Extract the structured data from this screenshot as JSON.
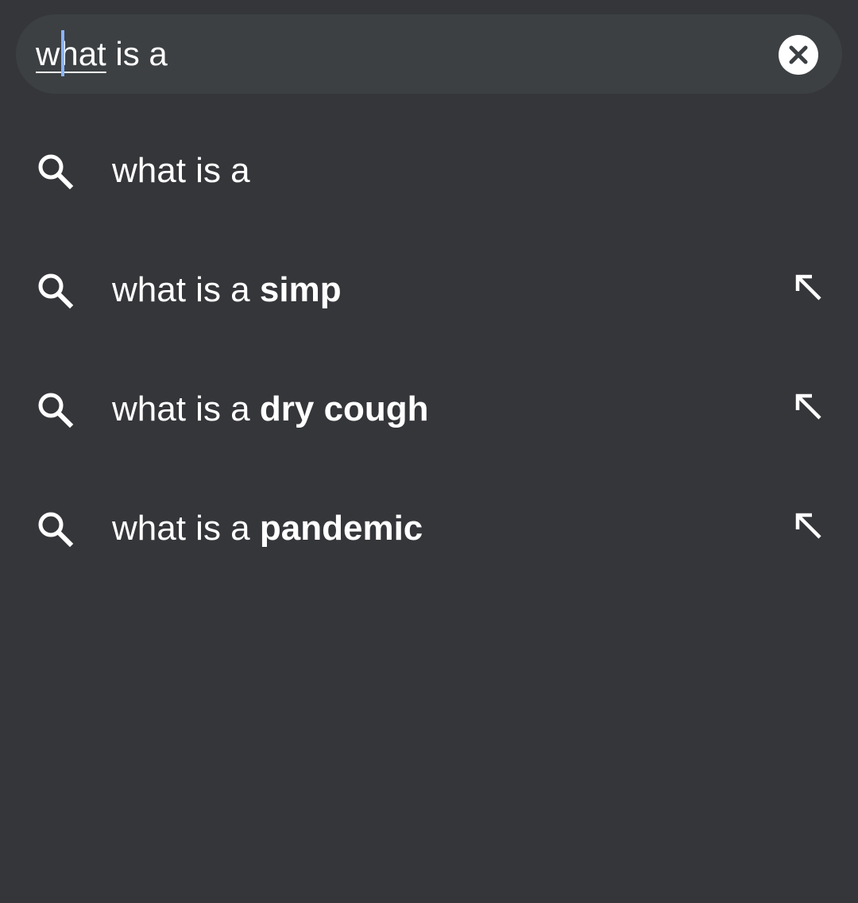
{
  "search": {
    "typed_prefix": "what",
    "rest": " is a",
    "clear_icon": "close-circle-icon"
  },
  "suggestions": [
    {
      "prefix": "what is a",
      "completion": "",
      "icon": "search-icon",
      "fill_icon": ""
    },
    {
      "prefix": "what is a ",
      "completion": "simp",
      "icon": "search-icon",
      "fill_icon": "arrow-up-left-icon"
    },
    {
      "prefix": "what is a ",
      "completion": "dry cough",
      "icon": "search-icon",
      "fill_icon": "arrow-up-left-icon"
    },
    {
      "prefix": "what is a ",
      "completion": "pandemic",
      "icon": "search-icon",
      "fill_icon": "arrow-up-left-icon"
    }
  ],
  "colors": {
    "background": "#35363a",
    "search_bar": "#3c4043",
    "caret": "#8ab4f8",
    "text": "#ffffff"
  }
}
